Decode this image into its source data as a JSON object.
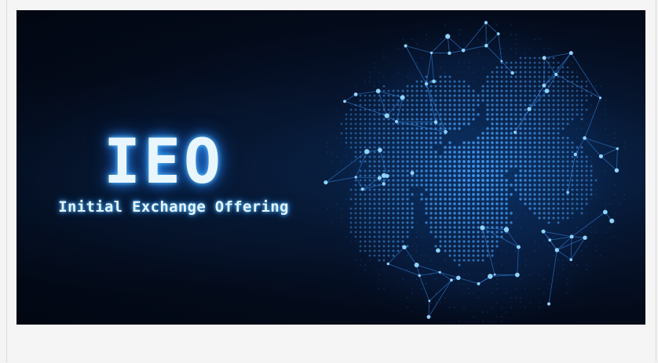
{
  "banner": {
    "title": "IEO",
    "subtitle": "Initial Exchange Offering",
    "image_subject": "globe-network-icon"
  },
  "colors": {
    "glow": "#2b8fff",
    "background": "#030a19",
    "node": "#8fd4ff",
    "link": "#2f7dd6"
  }
}
